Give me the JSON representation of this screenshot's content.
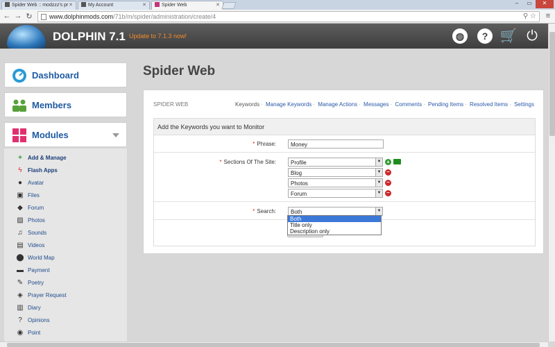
{
  "browser": {
    "tabs": [
      {
        "title": "Spider Web :: modzzz's pr"
      },
      {
        "title": "My Account"
      },
      {
        "title": "Spider Web"
      }
    ],
    "url_host": "www.dolphinmods.com",
    "url_path": "/71b/m/spider/administration/create/4"
  },
  "header": {
    "brand": "DOLPHIN 7.1",
    "update_link": "Update to 7.1.3 now!"
  },
  "sidebar": {
    "cards": [
      {
        "label": "Dashboard"
      },
      {
        "label": "Members"
      },
      {
        "label": "Modules"
      }
    ],
    "items": [
      {
        "label": "Add & Manage",
        "icon": "plus-icon"
      },
      {
        "label": "Flash Apps",
        "icon": "bolt-icon"
      },
      {
        "label": "Avatar",
        "icon": "user-icon"
      },
      {
        "label": "Files",
        "icon": "save-icon"
      },
      {
        "label": "Forum",
        "icon": "comments-icon"
      },
      {
        "label": "Photos",
        "icon": "picture-icon"
      },
      {
        "label": "Sounds",
        "icon": "music-icon"
      },
      {
        "label": "Videos",
        "icon": "film-icon"
      },
      {
        "label": "World Map",
        "icon": "map-marker-icon"
      },
      {
        "label": "Payment",
        "icon": "credit-card-icon"
      },
      {
        "label": "Poetry",
        "icon": "pencil-icon"
      },
      {
        "label": "Prayer Request",
        "icon": "tags-icon"
      },
      {
        "label": "Diary",
        "icon": "book-icon"
      },
      {
        "label": "Opinions",
        "icon": "question-icon"
      },
      {
        "label": "Point",
        "icon": "dot-icon"
      }
    ]
  },
  "main": {
    "title": "Spider Web",
    "panel_title": "SPIDER WEB",
    "links": [
      "Keywords",
      "Manage Keywords",
      "Manage Actions",
      "Messages",
      "Comments",
      "Pending Items",
      "Resolved Items",
      "Settings"
    ],
    "form": {
      "heading": "Add the Keywords you want to Monitor",
      "phrase_label": "Phrase:",
      "phrase_value": "Money",
      "sections_label": "Sections Of The Site:",
      "sections": [
        "Profile",
        "Blog",
        "Photos",
        "Forum"
      ],
      "search_label": "Search:",
      "search_value": "Both",
      "search_options": [
        "Both",
        "Title only",
        "Description only"
      ]
    }
  },
  "colors": {
    "link": "#2a59a8",
    "update": "#f28b2c",
    "selected_option": "#3b78d8"
  }
}
